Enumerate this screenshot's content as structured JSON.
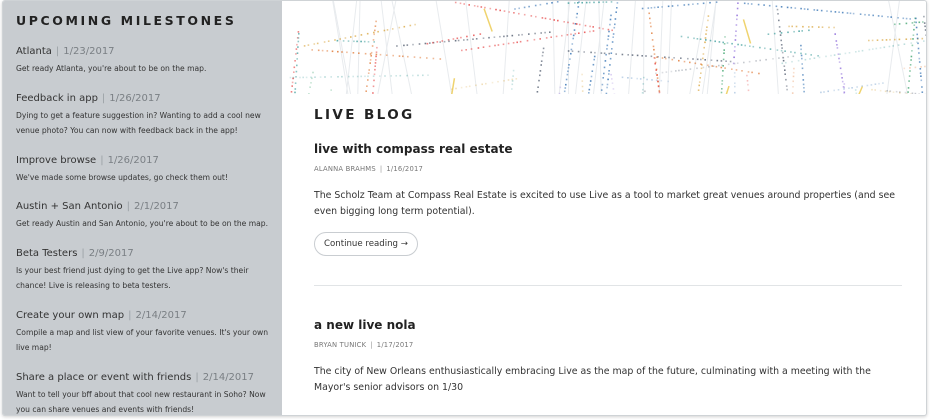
{
  "sidebar": {
    "title": "UPCOMING MILESTONES",
    "items": [
      {
        "title": "Atlanta",
        "date": "1/23/2017",
        "description": "Get ready Atlanta, you're about to be on the map."
      },
      {
        "title": "Feedback in app",
        "date": "1/26/2017",
        "description": "Dying to get a feature suggestion in? Wanting to add a cool new venue photo? You can now with feedback back in the app!"
      },
      {
        "title": "Improve browse",
        "date": "1/26/2017",
        "description": "We've made some browse updates, go check them out!"
      },
      {
        "title": "Austin + San Antonio",
        "date": "2/1/2017",
        "description": "Get ready Austin and San Antonio, you're about to be on the map."
      },
      {
        "title": "Beta Testers",
        "date": "2/9/2017",
        "description": "Is your best friend just dying to get the Live app? Now's their chance! Live is releasing to beta testers."
      },
      {
        "title": "Create your own map",
        "date": "2/14/2017",
        "description": "Compile a map and list view of your favorite venues. It's your own live map!"
      },
      {
        "title": "Share a place or event with friends",
        "date": "2/14/2017",
        "description": "Want to tell your bff about that cool new restaurant in Soho? Now you can share venues and events with friends!"
      }
    ],
    "separator": "|"
  },
  "main": {
    "section_title": "LIVE BLOG",
    "posts": [
      {
        "title": "live with compass real estate",
        "author": "ALANNA BRAHMS",
        "date": "1/16/2017",
        "excerpt": "The Scholz Team at Compass Real Estate is excited to use Live as a tool to market great venues around properties (and see even bigging long term potential).",
        "continue_label": "Continue reading →"
      },
      {
        "title": "a new live nola",
        "author": "BRYAN TUNICK",
        "date": "1/17/2017",
        "excerpt": "The city of New Orleans enthusiastically embracing Live as the map of the future, culminating with a meeting with the Mayor's senior advisors on 1/30"
      }
    ],
    "meta_separator": "|"
  },
  "colors": {
    "sidebar_bg": "#c8ccd0",
    "map_dot_colors": [
      "#2b6cb0",
      "#d69e2e",
      "#38a169",
      "#e53e3e",
      "#805ad5",
      "#dd6b20",
      "#319795",
      "#4a5568"
    ]
  }
}
